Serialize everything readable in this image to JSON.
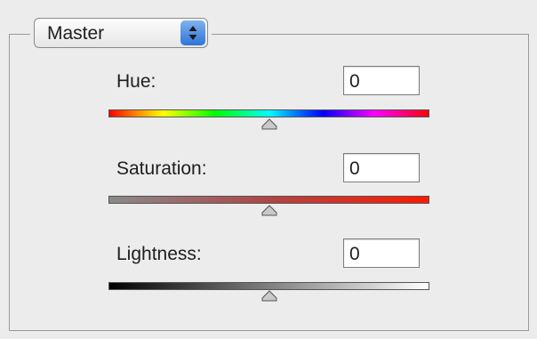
{
  "channel": {
    "selected": "Master"
  },
  "sliders": [
    {
      "label": "Hue:",
      "value": "0",
      "position": 0.5
    },
    {
      "label": "Saturation:",
      "value": "0",
      "position": 0.5
    },
    {
      "label": "Lightness:",
      "value": "0",
      "position": 0.5
    }
  ],
  "colors": {
    "background": "#ececec",
    "border": "#9a9a9a",
    "accent": "#2f75d6"
  }
}
